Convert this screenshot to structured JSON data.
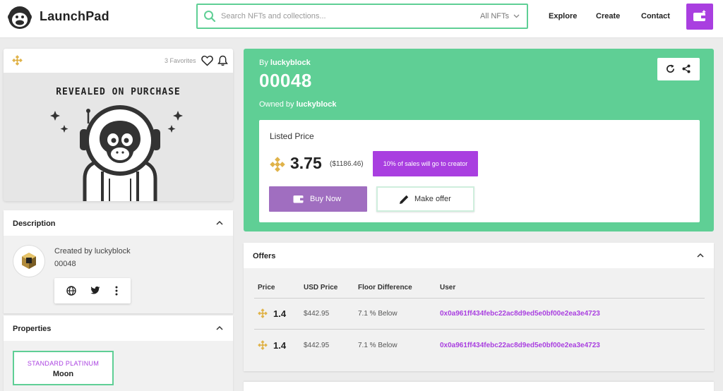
{
  "header": {
    "brand": "LaunchPad",
    "search_placeholder": "Search NFTs and collections...",
    "filter_label": "All NFTs",
    "nav": [
      "Explore",
      "Create",
      "Contact"
    ]
  },
  "media": {
    "favorites": "3 Favorites",
    "reveal_text": "REVEALED ON PURCHASE"
  },
  "description": {
    "title": "Description",
    "created_by": "Created by luckyblock",
    "token_id": "00048"
  },
  "properties": {
    "title": "Properties",
    "items": [
      {
        "type": "STANDARD PLATINUM",
        "value": "Moon"
      }
    ]
  },
  "item": {
    "by_prefix": "By",
    "creator": "luckyblock",
    "name": "00048",
    "owned_prefix": "Owned by",
    "owner": "luckyblock"
  },
  "listing": {
    "label": "Listed Price",
    "price": "3.75",
    "usd": "($1186.46)",
    "royalty": "10% of sales will go to creator",
    "buy_label": "Buy Now",
    "offer_label": "Make offer"
  },
  "offers": {
    "title": "Offers",
    "columns": [
      "Price",
      "USD Price",
      "Floor Difference",
      "User"
    ],
    "rows": [
      {
        "price": "1.4",
        "usd": "$442.95",
        "floor": "7.1 % Below",
        "user": "0x0a961ff434febc22ac8d9ed5e0bf00e2ea3e4723"
      },
      {
        "price": "1.4",
        "usd": "$442.95",
        "floor": "7.1 % Below",
        "user": "0x0a961ff434febc22ac8d9ed5e0bf00e2ea3e4723"
      }
    ]
  },
  "colors": {
    "accent_green": "#5fcf95",
    "accent_purple": "#a93fe0",
    "buy_button": "#a06ec0",
    "bnb_gold": "#e0b34a"
  },
  "icons": [
    "search-icon",
    "chevron-down-icon",
    "wallet-plus-icon",
    "bnb-icon",
    "heart-icon",
    "bell-icon",
    "globe-icon",
    "twitter-icon",
    "more-vertical-icon",
    "refresh-icon",
    "share-icon",
    "wallet-icon",
    "pencil-icon",
    "chevron-up-icon"
  ]
}
